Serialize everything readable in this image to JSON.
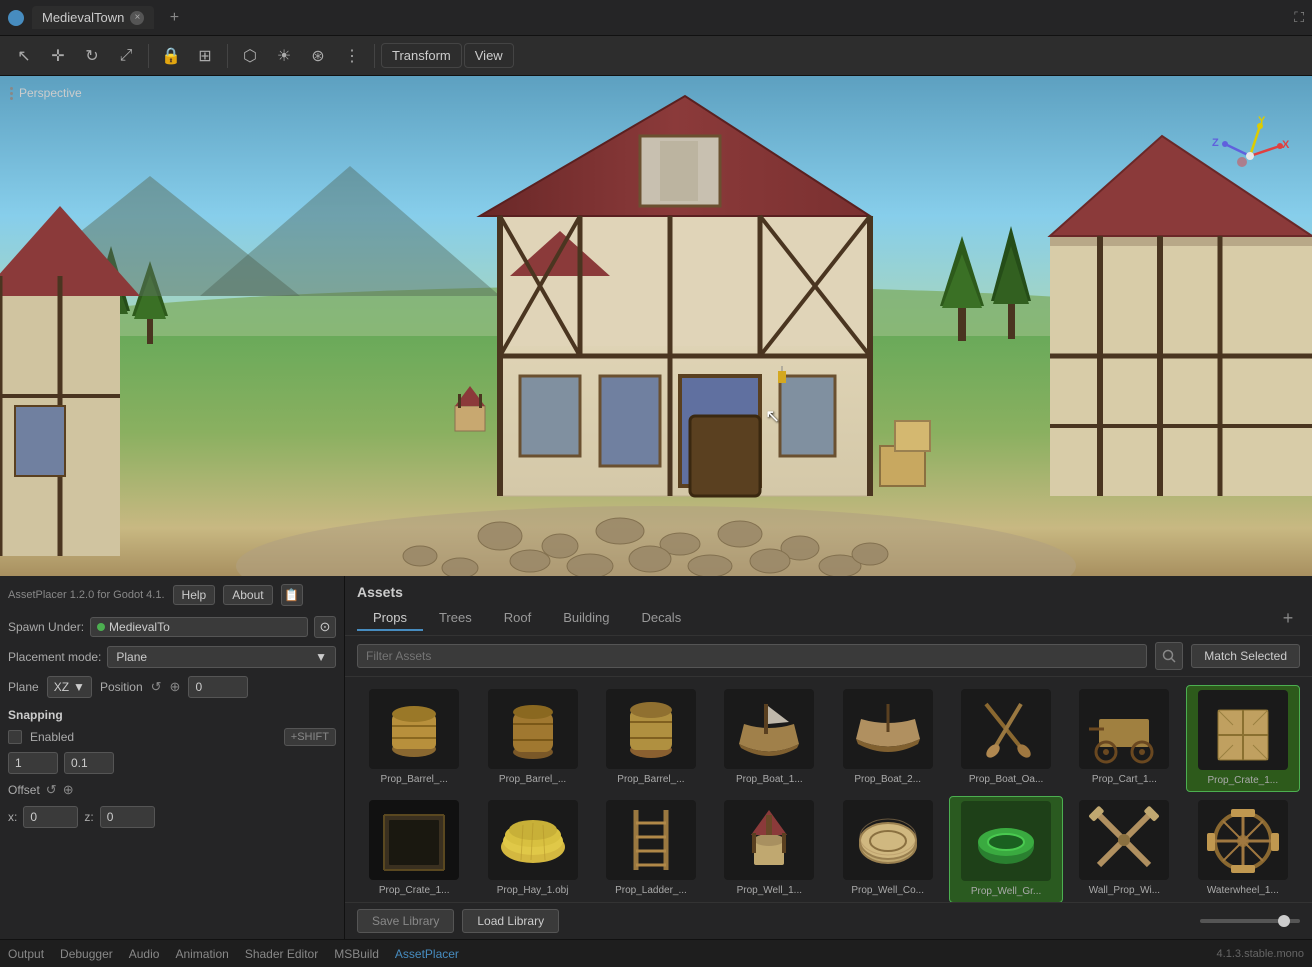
{
  "titlebar": {
    "tab_name": "MedievalTown",
    "close_label": "×",
    "add_tab_label": "+"
  },
  "toolbar": {
    "transform_label": "Transform",
    "view_label": "View",
    "more_label": "⋮"
  },
  "viewport": {
    "perspective_label": "Perspective"
  },
  "left_panel": {
    "version_text": "AssetPlacer 1.2.0 for Godot 4.1.",
    "help_label": "Help",
    "about_label": "About",
    "spawn_under_label": "Spawn Under:",
    "spawn_node": "MedievalTo",
    "placement_mode_label": "Placement mode:",
    "placement_mode_value": "Plane",
    "plane_label": "Plane",
    "position_label": "Position",
    "plane_axis": "XZ",
    "position_value": "0",
    "snapping_label": "Snapping",
    "enabled_label": "Enabled",
    "shift_label": "+SHIFT",
    "snap_value": "1",
    "snap_decimal": "0.1",
    "offset_label": "Offset",
    "x_label": "x:",
    "x_value": "0",
    "z_label": "z:",
    "z_value": "0"
  },
  "assets": {
    "panel_title": "Assets",
    "tabs": [
      {
        "label": "Props",
        "active": true
      },
      {
        "label": "Trees",
        "active": false
      },
      {
        "label": "Roof",
        "active": false
      },
      {
        "label": "Building",
        "active": false
      },
      {
        "label": "Decals",
        "active": false
      }
    ],
    "filter_placeholder": "Filter Assets",
    "match_selected_label": "Match Selected",
    "items": [
      {
        "name": "Prop_Barrel_...",
        "shape": "barrel1"
      },
      {
        "name": "Prop_Barrel_...",
        "shape": "barrel2"
      },
      {
        "name": "Prop_Barrel_...",
        "shape": "barrel3"
      },
      {
        "name": "Prop_Boat_1...",
        "shape": "boat1"
      },
      {
        "name": "Prop_Boat_2...",
        "shape": "boat2"
      },
      {
        "name": "Prop_Boat_Oa...",
        "shape": "boatoar"
      },
      {
        "name": "Prop_Cart_1...",
        "shape": "cart1"
      },
      {
        "name": "Prop_Crate_1...",
        "shape": "crate1",
        "selected": true
      },
      {
        "name": "Prop_Crate_1...",
        "shape": "crate2"
      },
      {
        "name": "Prop_Hay_1.obj",
        "shape": "hay1"
      },
      {
        "name": "Prop_Ladder_...",
        "shape": "ladder1"
      },
      {
        "name": "Prop_Well_1...",
        "shape": "well1"
      },
      {
        "name": "Prop_Well_Co...",
        "shape": "wellco"
      },
      {
        "name": "Prop_Well_Gr...",
        "shape": "wellgr"
      },
      {
        "name": "Wall_Prop_Wi...",
        "shape": "wallprop"
      },
      {
        "name": "Waterwheel_1...",
        "shape": "waterwheel"
      }
    ],
    "save_library_label": "Save Library",
    "load_library_label": "Load Library"
  },
  "statusbar": {
    "output_label": "Output",
    "debugger_label": "Debugger",
    "audio_label": "Audio",
    "animation_label": "Animation",
    "shader_editor_label": "Shader Editor",
    "msbuild_label": "MSBuild",
    "assetplacer_label": "AssetPlacer",
    "version_label": "4.1.3.stable.mono"
  }
}
